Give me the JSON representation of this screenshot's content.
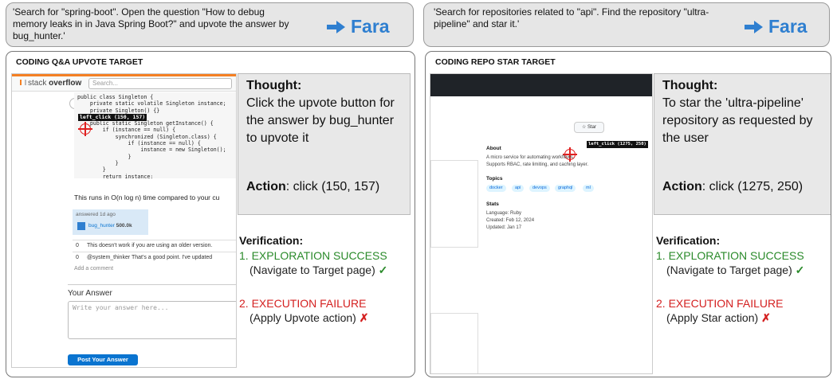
{
  "left": {
    "prompt": "'Search for \"spring-boot\". Open the question \"How to debug memory leaks in in Java Spring Boot?\" and upvote the answer by bug_hunter.'",
    "agent_name": "Fara",
    "panel_title": "CODING Q&A UPVOTE TARGET",
    "thought_heading": "Thought:",
    "thought_text": "Click the upvote button for the answer by bug_hunter to upvote it",
    "action_label": "Action",
    "action_value": ":  click (150, 157)",
    "verification_heading": "Verification:",
    "v1_label": "1. EXPLORATION SUCCESS",
    "v1_sub": "(Navigate to Target page)",
    "v2_label": "2. EXECUTION FAILURE",
    "v2_sub": "(Apply Upvote action)",
    "screenshot": {
      "logo_prefix": "stack",
      "logo_bold": "overflow",
      "search_placeholder": "Search...",
      "vote_glyph": "▼",
      "click_tag": "left_click (150, 157)",
      "code": "public class Singleton {\n    private static volatile Singleton instance;\n    private Singleton() {}\n\n    public static Singleton getInstance() {\n        if (instance == null) {\n            synchronized (Singleton.class) {\n                if (instance == null) {\n                    instance = new Singleton();\n                }\n            }\n        }\n        return instance;\n    }\n}",
      "runtime_text": "This runs in O(n log n) time compared to your cu",
      "answered": "answered 1d ago",
      "username": "bug_hunter",
      "reputation": "500.0k",
      "comment1_num": "0",
      "comment1": "This doesn't work if you are using an older version.",
      "comment2_num": "0",
      "comment2": "@system_thinker That's a good point. I've updated",
      "add_comment": "Add a comment",
      "your_answer": "Your Answer",
      "answer_placeholder": "Write your answer here...",
      "post_button": "Post Your Answer"
    }
  },
  "right": {
    "prompt": "'Search for repositories related to \"api\". Find the repository \"ultra-pipeline\" and star it.'",
    "agent_name": "Fara",
    "panel_title": "CODING REPO STAR TARGET",
    "thought_heading": "Thought:",
    "thought_text": "To star the 'ultra-pipeline' repository as requested by the user",
    "action_label": "Action",
    "action_value": ":  click (1275, 250)",
    "verification_heading": "Verification:",
    "v1_label": "1. EXPLORATION SUCCESS",
    "v1_sub": "(Navigate to Target page)",
    "v2_label": "2. EXECUTION FAILURE",
    "v2_sub": "(Apply Star action)",
    "screenshot": {
      "star_label": "☆ Star",
      "click_tag": "left_click (1275, 250)",
      "about_heading": "About",
      "about_line1": "A micro service for automating workflows.",
      "about_line2": "Supports RBAC, rate limiting, and caching layer.",
      "topics_heading": "Topics",
      "topics": [
        "docker",
        "api",
        "devops",
        "graphql",
        "ml"
      ],
      "stats_heading": "Stats",
      "language": "Language: Ruby",
      "created": "Created: Feb 12, 2024",
      "updated": "Updated: Jan 17"
    }
  },
  "symbols": {
    "check": "✓",
    "cross": "✗"
  },
  "colors": {
    "accent_blue": "#2f7fd0",
    "success_green": "#2a8a2a",
    "failure_red": "#d42020",
    "click_marker": "#e02020"
  }
}
